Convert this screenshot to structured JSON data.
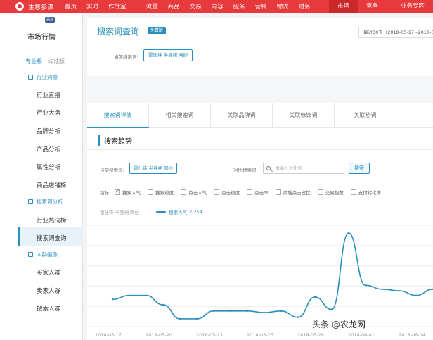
{
  "topnav": {
    "brand": "生意参谋",
    "items": [
      "首页",
      "实时",
      "作战室",
      "流量",
      "商品",
      "交易",
      "内容",
      "服务",
      "营销",
      "物流",
      "财务"
    ],
    "right": [
      "市场",
      "竞争",
      "业务专区"
    ]
  },
  "sidebar": {
    "badge": "品皇",
    "title": "市场行情",
    "version_tabs": [
      "专业版",
      "标准版"
    ],
    "sections": [
      {
        "label": "行业洞察",
        "items": [
          "行业直播",
          "行业大盘",
          "品牌分析",
          "产品分析",
          "属性分析",
          "商品店铺榜"
        ]
      },
      {
        "label": "搜索词分析",
        "items": [
          "行业热词榜",
          "搜索词查询"
        ]
      },
      {
        "label": "人群画像",
        "items": [
          "买家人群",
          "卖家人群",
          "搜索人群"
        ]
      }
    ],
    "active_item": "搜索词查询"
  },
  "header": {
    "title": "搜索词查询",
    "tag": "免费版",
    "date_range": "最近30天（2018-05-17~2018-06-15）",
    "current_keyword_label": "当前搜索词:",
    "current_keyword": "雷仕锋 半身裙 网纱"
  },
  "tabs": [
    "搜索词详情",
    "相关搜索词",
    "关联品牌词",
    "关联修饰词",
    "关联热词"
  ],
  "trend": {
    "section_title": "搜索趋势",
    "current_label": "当前搜索词:",
    "current_value": "雷仕锋 半身裙 网纱",
    "compare_label": "对比搜索词:",
    "compare_placeholder": "请输入对比词",
    "search_button": "搜索",
    "metrics_label": "指标:",
    "metrics": [
      {
        "label": "搜索人气",
        "checked": true
      },
      {
        "label": "搜索热度",
        "checked": false
      },
      {
        "label": "点击人气",
        "checked": false
      },
      {
        "label": "点击热度",
        "checked": false
      },
      {
        "label": "点击率",
        "checked": false
      },
      {
        "label": "商城点击占比",
        "checked": false
      },
      {
        "label": "交易指数",
        "checked": false
      },
      {
        "label": "支付转化率",
        "checked": false
      }
    ],
    "legend_keyword": "雷仕锋 半身裙 网纱",
    "legend_series": "搜索人气",
    "legend_value": "2,254"
  },
  "chart_data": {
    "type": "line",
    "x": [
      "2018-05-17",
      "2018-05-18",
      "2018-05-19",
      "2018-05-20",
      "2018-05-21",
      "2018-05-22",
      "2018-05-23",
      "2018-05-24",
      "2018-05-25",
      "2018-05-26",
      "2018-05-27",
      "2018-05-28",
      "2018-05-29",
      "2018-05-30",
      "2018-05-31",
      "2018-06-01",
      "2018-06-02",
      "2018-06-03",
      "2018-06-04",
      "2018-06-05"
    ],
    "xticks": [
      "2018-05-17",
      "2018-05-20",
      "2018-05-23",
      "2018-05-26",
      "2018-05-29",
      "2018-06-01",
      "2018-06-04"
    ],
    "series": [
      {
        "name": "搜索人气",
        "values": [
          1850,
          1900,
          1900,
          1780,
          1600,
          1600,
          1700,
          1700,
          1700,
          1680,
          1700,
          1620,
          1880,
          1720,
          2700,
          2030,
          1980,
          1960,
          1900,
          1980
        ]
      }
    ],
    "ylim": [
      1500,
      2800
    ],
    "color": "#2a8fbd",
    "grid": true
  },
  "watermark": {
    "text": "头条 @农",
    "brand": "龙网"
  }
}
